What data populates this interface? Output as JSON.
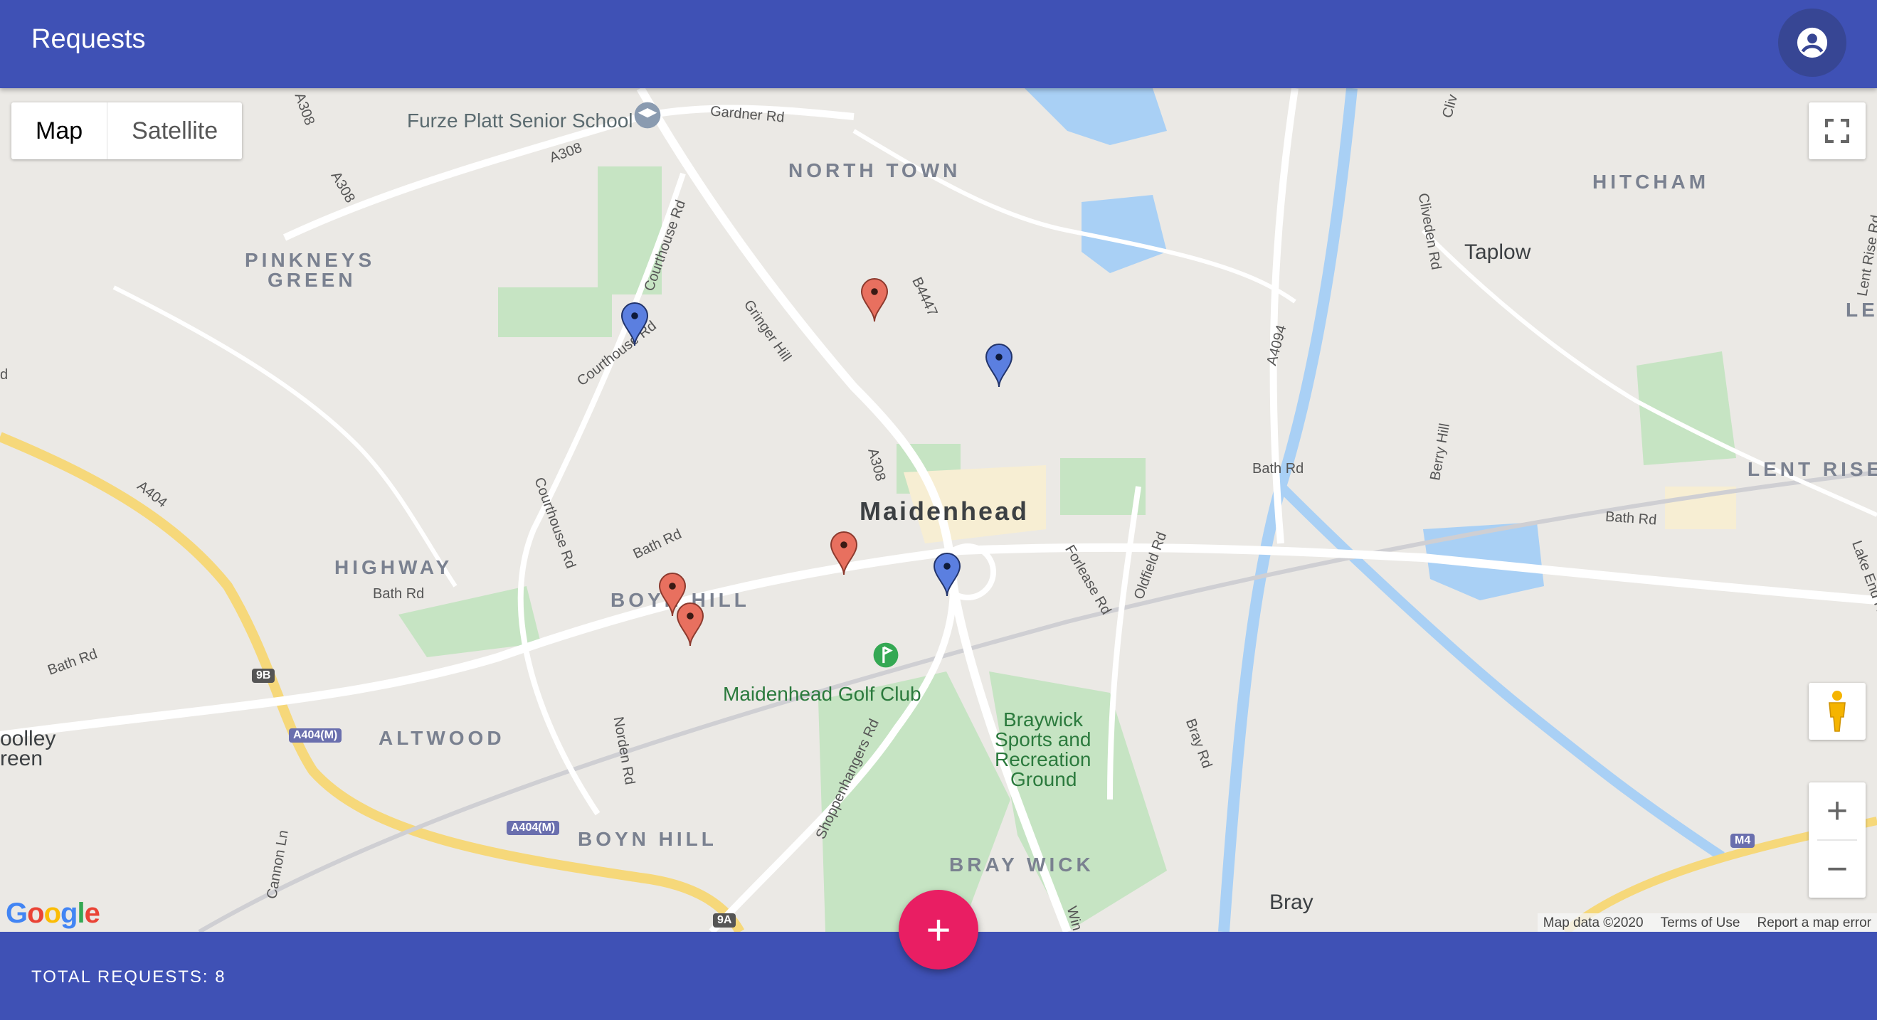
{
  "app": {
    "title": "Requests",
    "account_icon": "account-circle-icon"
  },
  "map": {
    "type_control": {
      "map_label": "Map",
      "satellite_label": "Satellite",
      "selected": "Map"
    },
    "labels": {
      "furze_platt": "Furze Platt Senior School",
      "north_town": "NORTH TOWN",
      "hitcham": "HITCHAM",
      "pinkneys1": "PINKNEYS",
      "pinkneys2": "GREEN",
      "taplow": "Taplow",
      "lent": "LEN",
      "lent_rise": "LENT RISE",
      "maidenhead": "Maidenhead",
      "highway": "HIGHWAY",
      "boyn_hill_1": "BOYN HILL",
      "boyn_hill_2": "BOYN HILL",
      "altwood": "ALTWOOD",
      "golf": "Maidenhead Golf Club",
      "braywick1": "Braywick",
      "braywick2": "Sports and",
      "braywick3": "Recreation",
      "braywick4": "Ground",
      "bray_wick": "BRAY WICK",
      "bray": "Bray",
      "cooley1": "oolley",
      "cooley2": "reen",
      "roads": {
        "gardner": "Gardner Rd",
        "a308a": "A308",
        "a308b": "A308",
        "a308c": "A308",
        "a308d": "A308",
        "courthouse1": "Courthouse Rd",
        "courthouse2": "Courthouse Rd",
        "courthouse3": "Courthouse Rd",
        "gringer": "Gringer Hill",
        "b4447": "B4447",
        "cliveden": "Cliveden Rd",
        "cliv": "Cliv",
        "lentrise_rd": "Lent Rise Rd",
        "a4094": "A4094",
        "berry": "Berry Hill",
        "bath1": "Bath Rd",
        "bath2": "Bath Rd",
        "bath3": "Bath Rd",
        "bath4": "Bath Rd",
        "bath5": "Bath Rd",
        "a404": "A404",
        "forlease": "Forlease Rd",
        "oldfield": "Oldfield Rd",
        "lakeend": "Lake End Rd",
        "norden": "Norden Rd",
        "shoppenhangers": "Shoppenhangers Rd",
        "bray_rd": "Bray Rd",
        "cannon": "Cannon Ln",
        "rd": "d",
        "win": "Win"
      },
      "shields": {
        "s9b": "9B",
        "a404m1": "A404(M)",
        "a404m2": "A404(M)",
        "s9a": "9A",
        "m4": "M4"
      }
    },
    "markers": [
      {
        "color": "#e8705f"
      },
      {
        "color": "#e8705f"
      },
      {
        "color": "#e8705f"
      },
      {
        "color": "#e8705f"
      },
      {
        "color": "#5b7fe0"
      },
      {
        "color": "#5b7fe0"
      },
      {
        "color": "#5b7fe0"
      }
    ],
    "attribution": {
      "data": "Map data ©2020",
      "terms": "Terms of Use",
      "report": "Report a map error"
    },
    "logo": "Google",
    "zoom_in": "+",
    "zoom_out": "−"
  },
  "footer": {
    "total_label": "TOTAL REQUESTS: 8"
  },
  "fab": {
    "label": "+",
    "icon": "add-icon"
  },
  "colors": {
    "primary": "#3f51b5",
    "accent": "#e91e63",
    "marker_red": "#e8705f",
    "marker_blue": "#5b7fe0"
  }
}
